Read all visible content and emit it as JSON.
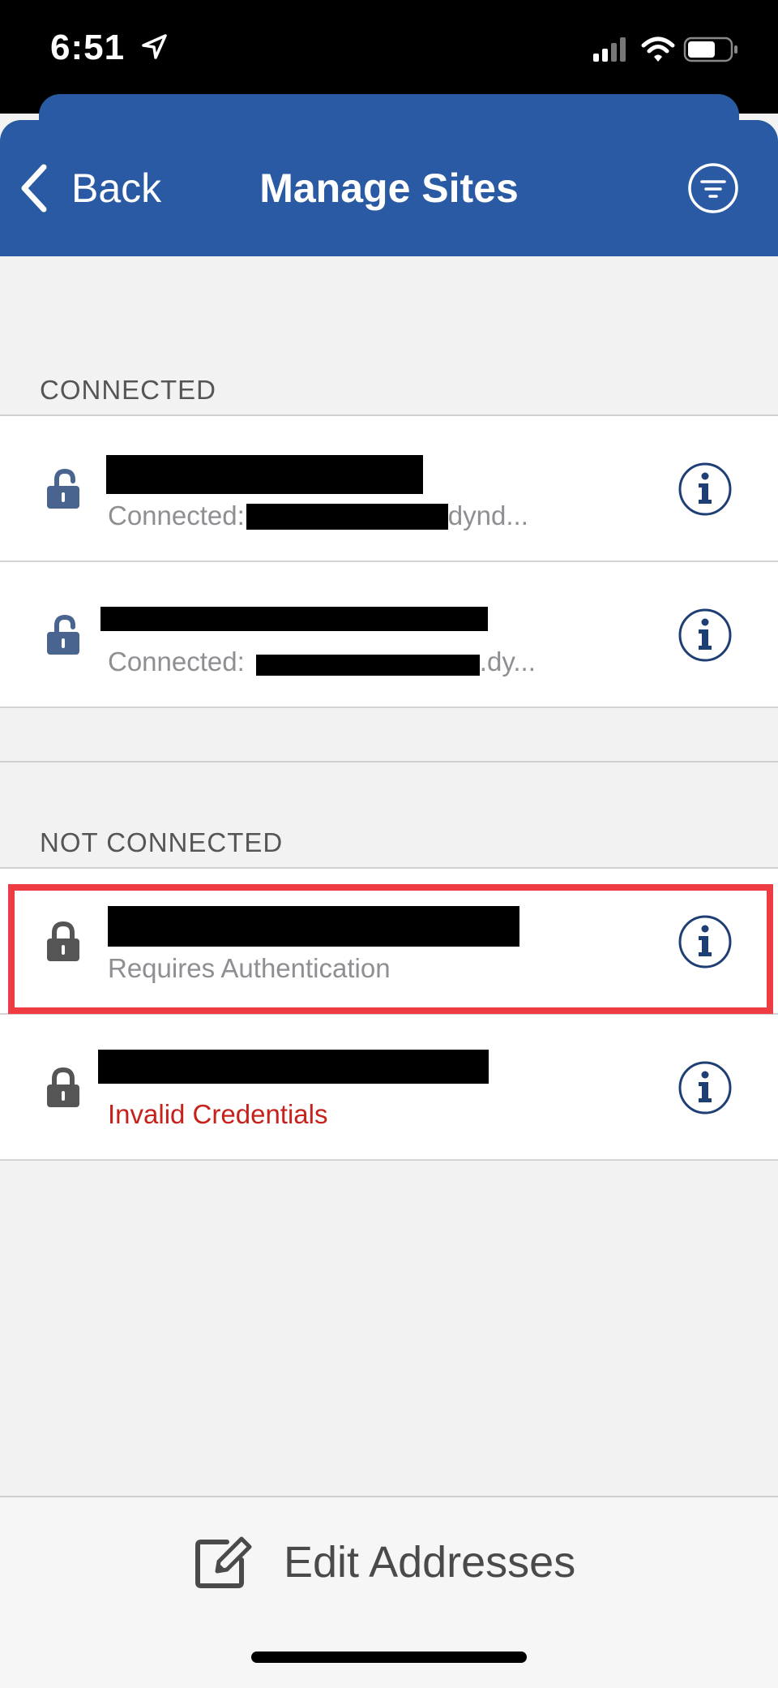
{
  "status_bar": {
    "time": "6:51"
  },
  "nav": {
    "back_label": "Back",
    "title": "Manage Sites"
  },
  "sections": {
    "connected": {
      "header": "CONNECTED",
      "rows": [
        {
          "subtitle_prefix": "Connected:",
          "subtitle_suffix": "dynd..."
        },
        {
          "subtitle_prefix": "Connected:",
          "subtitle_suffix": ".dy..."
        }
      ]
    },
    "not_connected": {
      "header": "NOT CONNECTED",
      "rows": [
        {
          "subtitle": "Requires Authentication"
        },
        {
          "subtitle": "Invalid Credentials"
        }
      ]
    }
  },
  "bottom": {
    "edit_label": "Edit Addresses"
  },
  "colors": {
    "nav_blue": "#2a5aa3",
    "highlight": "#ef3c43",
    "error": "#c7211c",
    "info_icon": "#1e3f73"
  }
}
